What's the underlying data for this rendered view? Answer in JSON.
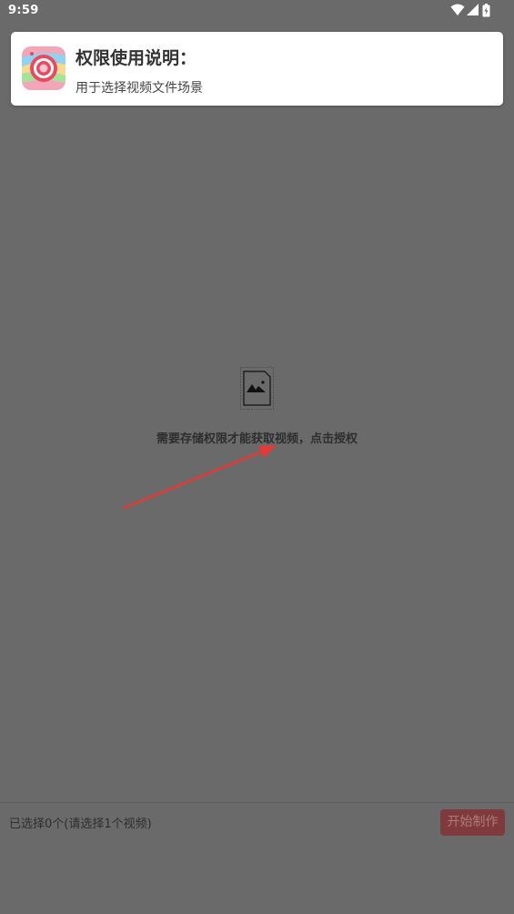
{
  "status_bar": {
    "time": "9:59",
    "icons": [
      "wifi-icon",
      "signal-icon",
      "battery-icon"
    ]
  },
  "permission_card": {
    "app_icon": "camera-lens-app-icon",
    "title": "权限使用说明：",
    "description": "用于选择视频文件场景"
  },
  "main": {
    "placeholder_icon": "image-file-icon",
    "message": "需要存储权限才能获取视频，点击授权"
  },
  "bottom_bar": {
    "selection_status": "已选择0个(请选择1个视频)",
    "start_button_label": "开始制作"
  },
  "colors": {
    "overlay_background": "#6a6a6a",
    "accent_red": "#e53935",
    "start_button_bg": "#7e3a3c"
  }
}
